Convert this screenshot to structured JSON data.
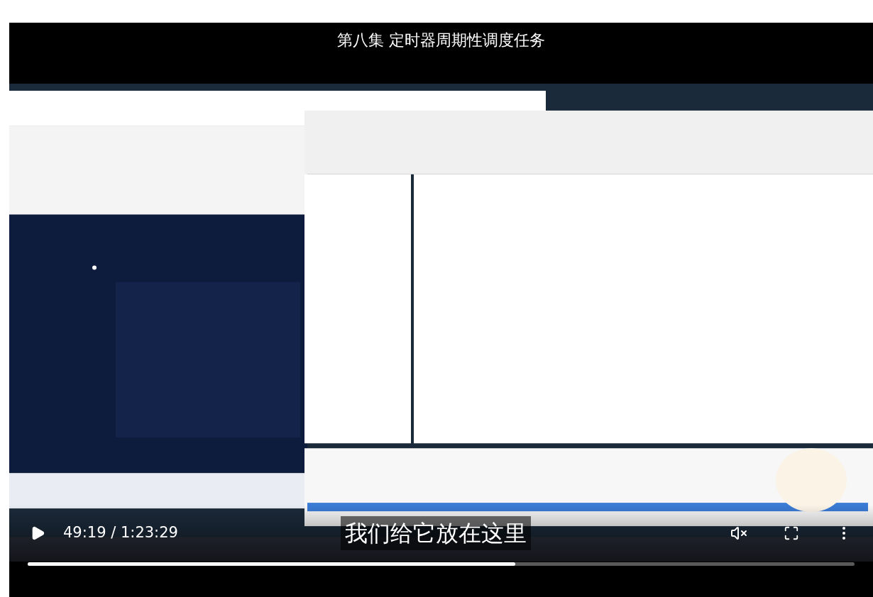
{
  "title": "第八集 定时器周期性调度任务",
  "caption": "我们给它放在这里",
  "controls": {
    "playing": false,
    "time": "49:19 / 1:23:29",
    "muted": true
  },
  "progress": {
    "level": 0.59
  }
}
